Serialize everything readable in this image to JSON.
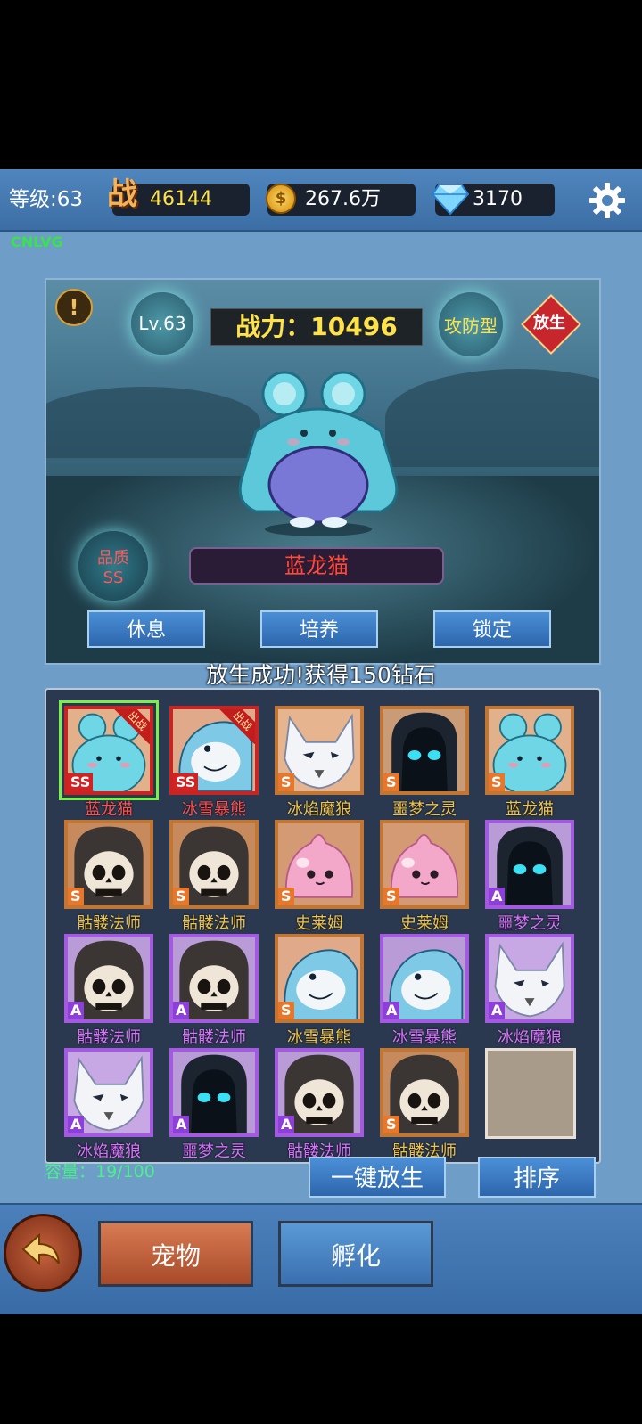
{
  "topbar": {
    "level_text": "等级:63",
    "power_icon": "战",
    "power_value": "46144",
    "coin_value": "267.6万",
    "diamond_value": "3170",
    "settings_icon": "gear-icon"
  },
  "player_tag": "CNLVG",
  "pet_detail": {
    "level": "Lv.63",
    "power_label": "战力：10496",
    "type": "攻防型",
    "release_label": "放生",
    "quality_label": "品质",
    "quality_value": "SS",
    "name": "蓝龙猫",
    "buttons": [
      "休息",
      "培养",
      "锁定"
    ]
  },
  "message": "放生成功!获得150钻石",
  "pets": [
    {
      "name": "蓝龙猫",
      "grade": "SS",
      "deployed": "出战",
      "kind": "mouse",
      "selected": true
    },
    {
      "name": "冰雪暴熊",
      "grade": "SS",
      "deployed": "出战",
      "kind": "shark"
    },
    {
      "name": "冰焰魔狼",
      "grade": "S",
      "kind": "wolf"
    },
    {
      "name": "噩梦之灵",
      "grade": "S",
      "kind": "ghost"
    },
    {
      "name": "蓝龙猫",
      "grade": "S",
      "kind": "mouse"
    },
    {
      "name": "骷髅法师",
      "grade": "S",
      "kind": "skull"
    },
    {
      "name": "骷髅法师",
      "grade": "S",
      "kind": "skull"
    },
    {
      "name": "史莱姆",
      "grade": "S",
      "kind": "slime"
    },
    {
      "name": "史莱姆",
      "grade": "S",
      "kind": "slime"
    },
    {
      "name": "噩梦之灵",
      "grade": "A",
      "kind": "ghost"
    },
    {
      "name": "骷髅法师",
      "grade": "A",
      "kind": "skull"
    },
    {
      "name": "骷髅法师",
      "grade": "A",
      "kind": "skull"
    },
    {
      "name": "冰雪暴熊",
      "grade": "S",
      "kind": "shark"
    },
    {
      "name": "冰雪暴熊",
      "grade": "A",
      "kind": "shark"
    },
    {
      "name": "冰焰魔狼",
      "grade": "A",
      "kind": "wolf"
    },
    {
      "name": "冰焰魔狼",
      "grade": "A",
      "kind": "wolf"
    },
    {
      "name": "噩梦之灵",
      "grade": "A",
      "kind": "ghost"
    },
    {
      "name": "骷髅法师",
      "grade": "A",
      "kind": "skull"
    },
    {
      "name": "骷髅法师",
      "grade": "S",
      "kind": "skull"
    }
  ],
  "capacity": "容量：19/100",
  "actions": {
    "release_all": "一键放生",
    "sort": "排序"
  },
  "bottom_tabs": {
    "pets": "宠物",
    "hatch": "孵化",
    "back_icon": "back-arrow-icon"
  }
}
